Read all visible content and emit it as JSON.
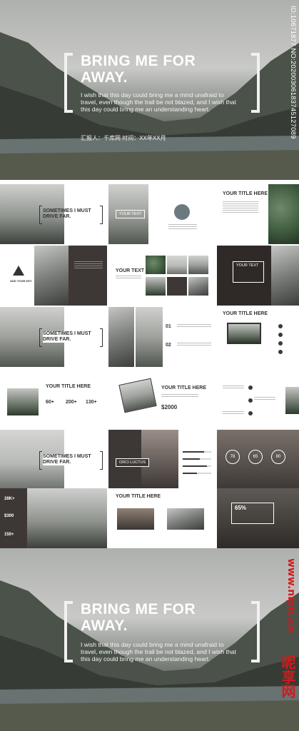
{
  "hero": {
    "title_line1": "BRING ME FOR",
    "title_line2": "AWAY.",
    "subtitle": "I wish that this day could bring me a mind unafraid to travel, even though the trail be not blazed, and I wish that this day could bring me an understanding heart.",
    "meta": "汇报人：千库网   时间：XX年XX月"
  },
  "watermark": {
    "id": "ID:10671877 NO:20200306183745127089",
    "site": "www.nipic.cn",
    "brand": "昵享网"
  },
  "slides": {
    "s1_title": "SOMETIMES I MUST DRIVE FAR.",
    "s2_label": "YOUR TEXT",
    "s3_title": "YOUR TITLE HERE",
    "s4_label": "ADD YOUR KEY",
    "s5_label": "YOUR TEXT",
    "s6_label": "YOUR TEXT",
    "s7_title": "SOMETIMES I MUST DRIVE FAR.",
    "s8_num1": "01",
    "s8_num2": "02",
    "s9_title": "YOUR TITLE HERE",
    "s10_title": "YOUR TITLE HERE",
    "s10_stats": [
      "60+",
      "200+",
      "130+"
    ],
    "s11_title": "YOUR TITLE HERE",
    "s11_price": "$2000",
    "s12_title": "SOMETIMES I MUST DRIVE FAR.",
    "s13_label": "ORCI LUCTUS",
    "s14_stats": [
      "78",
      "65",
      "80"
    ],
    "s15_stats": [
      "28K+",
      "$300",
      "150+"
    ],
    "s16_title": "YOUR TITLE HERE",
    "s17_stat": "65%"
  },
  "colors": {
    "accent_dark": "#3d3836",
    "watermark_red": "#d21a1a"
  }
}
